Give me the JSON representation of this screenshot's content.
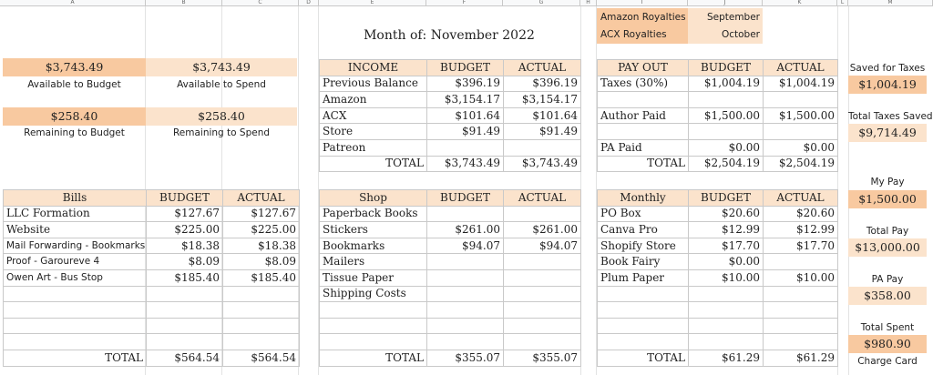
{
  "colors": {
    "peach": "#fbe3cc",
    "peach_dark": "#f8c9a0",
    "grid": "#c9c9c9"
  },
  "headers": [
    "A",
    "B",
    "C",
    "D",
    "E",
    "F",
    "G",
    "H",
    "I",
    "J",
    "K",
    "L",
    "M"
  ],
  "title": "Month of: November 2022",
  "royalties": {
    "amazon_label": "Amazon Royalties",
    "amazon_month": "September",
    "acx_label": "ACX Royalties",
    "acx_month": "October"
  },
  "summary": {
    "available_to_budget_value": "$3,743.49",
    "available_to_budget_label": "Available to Budget",
    "available_to_spend_value": "$3,743.49",
    "available_to_spend_label": "Available to Spend",
    "remaining_to_budget_value": "$258.40",
    "remaining_to_budget_label": "Remaining to Budget",
    "remaining_to_spend_value": "$258.40",
    "remaining_to_spend_label": "Remaining to Spend"
  },
  "income": {
    "headers": [
      "INCOME",
      "BUDGET",
      "ACTUAL"
    ],
    "rows": [
      [
        "Previous Balance",
        "$396.19",
        "$396.19"
      ],
      [
        "Amazon",
        "$3,154.17",
        "$3,154.17"
      ],
      [
        "ACX",
        "$101.64",
        "$101.64"
      ],
      [
        "Store",
        "$91.49",
        "$91.49"
      ],
      [
        "Patreon",
        "",
        ""
      ]
    ],
    "total": [
      "TOTAL",
      "$3,743.49",
      "$3,743.49"
    ]
  },
  "payout": {
    "headers": [
      "PAY OUT",
      "BUDGET",
      "ACTUAL"
    ],
    "rows": [
      [
        "Taxes (30%)",
        "$1,004.19",
        "$1,004.19"
      ],
      [
        "",
        "",
        ""
      ],
      [
        "Author Paid",
        "$1,500.00",
        "$1,500.00"
      ],
      [
        "",
        "",
        ""
      ],
      [
        "PA Paid",
        "$0.00",
        "$0.00"
      ]
    ],
    "total": [
      "TOTAL",
      "$2,504.19",
      "$2,504.19"
    ]
  },
  "bills": {
    "headers": [
      "Bills",
      "BUDGET",
      "ACTUAL"
    ],
    "rows": [
      [
        "LLC Formation",
        "$127.67",
        "$127.67"
      ],
      [
        "Website",
        "$225.00",
        "$225.00"
      ],
      [
        "Mail Forwarding - Bookmarks",
        "$18.38",
        "$18.38"
      ],
      [
        "Proof - Garoureve 4",
        "$8.09",
        "$8.09"
      ],
      [
        "Owen Art - Bus Stop",
        "$185.40",
        "$185.40"
      ],
      [
        "",
        "",
        ""
      ],
      [
        "",
        "",
        ""
      ],
      [
        "",
        "",
        ""
      ],
      [
        "",
        "",
        ""
      ]
    ],
    "small_font_rows": [
      2,
      3,
      4
    ],
    "total": [
      "TOTAL",
      "$564.54",
      "$564.54"
    ]
  },
  "shop": {
    "headers": [
      "Shop",
      "BUDGET",
      "ACTUAL"
    ],
    "rows": [
      [
        "Paperback Books",
        "",
        ""
      ],
      [
        "Stickers",
        "$261.00",
        "$261.00"
      ],
      [
        "Bookmarks",
        "$94.07",
        "$94.07"
      ],
      [
        "Mailers",
        "",
        ""
      ],
      [
        "Tissue Paper",
        "",
        ""
      ],
      [
        "Shipping Costs",
        "",
        ""
      ],
      [
        "",
        "",
        ""
      ],
      [
        "",
        "",
        ""
      ],
      [
        "",
        "",
        ""
      ]
    ],
    "total": [
      "TOTAL",
      "$355.07",
      "$355.07"
    ]
  },
  "monthly": {
    "headers": [
      "Monthly",
      "BUDGET",
      "ACTUAL"
    ],
    "rows": [
      [
        "PO Box",
        "$20.60",
        "$20.60"
      ],
      [
        "Canva Pro",
        "$12.99",
        "$12.99"
      ],
      [
        "Shopify Store",
        "$17.70",
        "$17.70"
      ],
      [
        "Book Fairy",
        "$0.00",
        ""
      ],
      [
        "Plum Paper",
        "$10.00",
        "$10.00"
      ],
      [
        "",
        "",
        ""
      ],
      [
        "",
        "",
        ""
      ],
      [
        "",
        "",
        ""
      ],
      [
        "",
        "",
        ""
      ]
    ],
    "total": [
      "TOTAL",
      "$61.29",
      "$61.29"
    ]
  },
  "sidebar": [
    {
      "label": "Saved for Taxes",
      "value": "$1,004.19"
    },
    {
      "label": "Total Taxes Saved",
      "value": "$9,714.49"
    },
    {
      "label": "My Pay",
      "value": "$1,500.00"
    },
    {
      "label": "Total Pay",
      "value": "$13,000.00"
    },
    {
      "label": "PA Pay",
      "value": "$358.00"
    },
    {
      "label": "Total Spent",
      "value": "$980.90"
    },
    {
      "label": "Charge Card",
      "value": ""
    }
  ]
}
